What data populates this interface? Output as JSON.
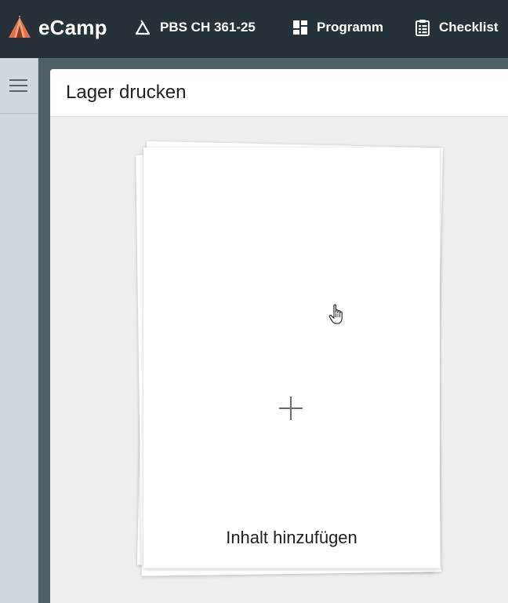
{
  "app": {
    "name": "eCamp",
    "logo_icon": "tent-logo-icon",
    "brand_color": "#e0714a"
  },
  "nav": [
    {
      "label": "PBS CH 361-25",
      "icon": "camp-tent-icon"
    },
    {
      "label": "Programm",
      "icon": "dashboard-grid-icon"
    },
    {
      "label": "Checklist",
      "icon": "clipboard-list-icon"
    }
  ],
  "sidebar": {
    "menu_icon": "hamburger-menu-icon"
  },
  "page": {
    "title": "Lager drucken",
    "add_content_label": "Inhalt hinzufügen",
    "add_icon": "plus-icon"
  },
  "colors": {
    "topbar": "#263238",
    "rail": "#cfd8dc",
    "card_bg": "#eeeeee"
  }
}
